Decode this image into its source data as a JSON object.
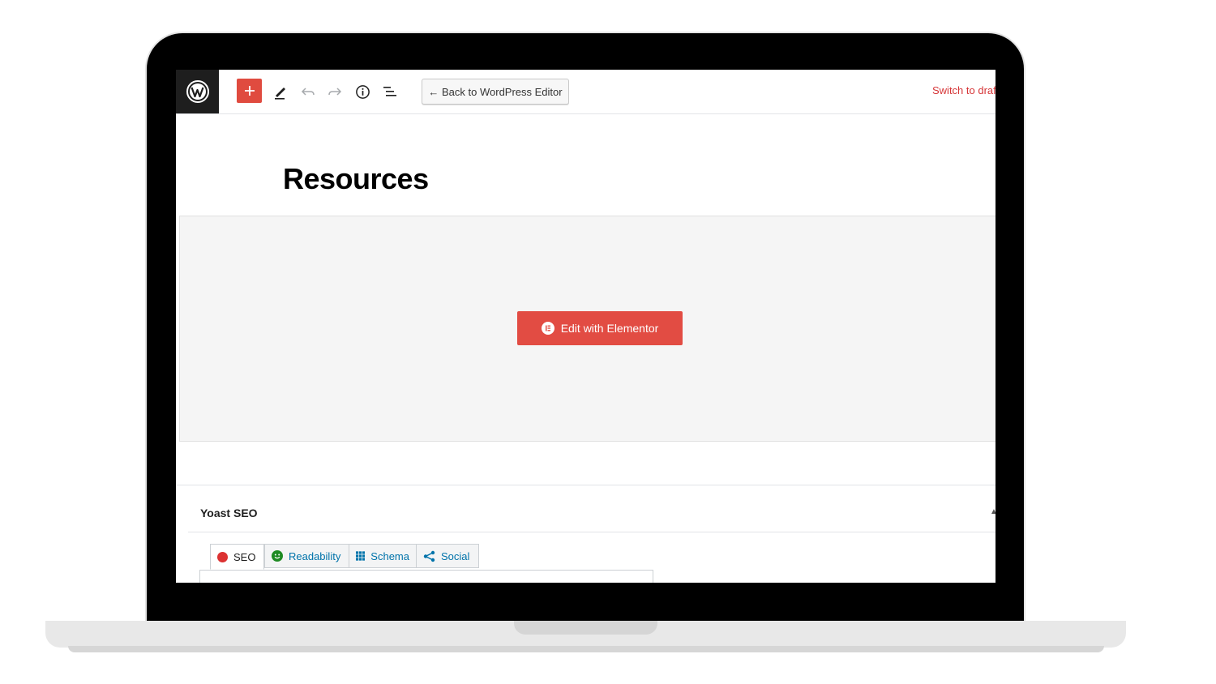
{
  "toolbar": {
    "back_label": "← Back to WordPress Editor",
    "switch_label": "Switch to draf",
    "icons": [
      "wordpress-icon",
      "plus-icon",
      "pencil-icon",
      "undo-icon",
      "redo-icon",
      "info-icon",
      "list-view-icon"
    ]
  },
  "page": {
    "title": "Resources"
  },
  "elementor": {
    "button_label": "Edit with Elementor"
  },
  "yoast": {
    "title": "Yoast SEO",
    "tabs": [
      {
        "label": "SEO",
        "icon": "red-dot-icon"
      },
      {
        "label": "Readability",
        "icon": "smiley-icon"
      },
      {
        "label": "Schema",
        "icon": "grid-icon"
      },
      {
        "label": "Social",
        "icon": "share-icon"
      }
    ]
  },
  "colors": {
    "accent_red": "#e24c43",
    "link_blue": "#0073aa",
    "good_green": "#1e8a23",
    "bad_red": "#dc3232"
  }
}
